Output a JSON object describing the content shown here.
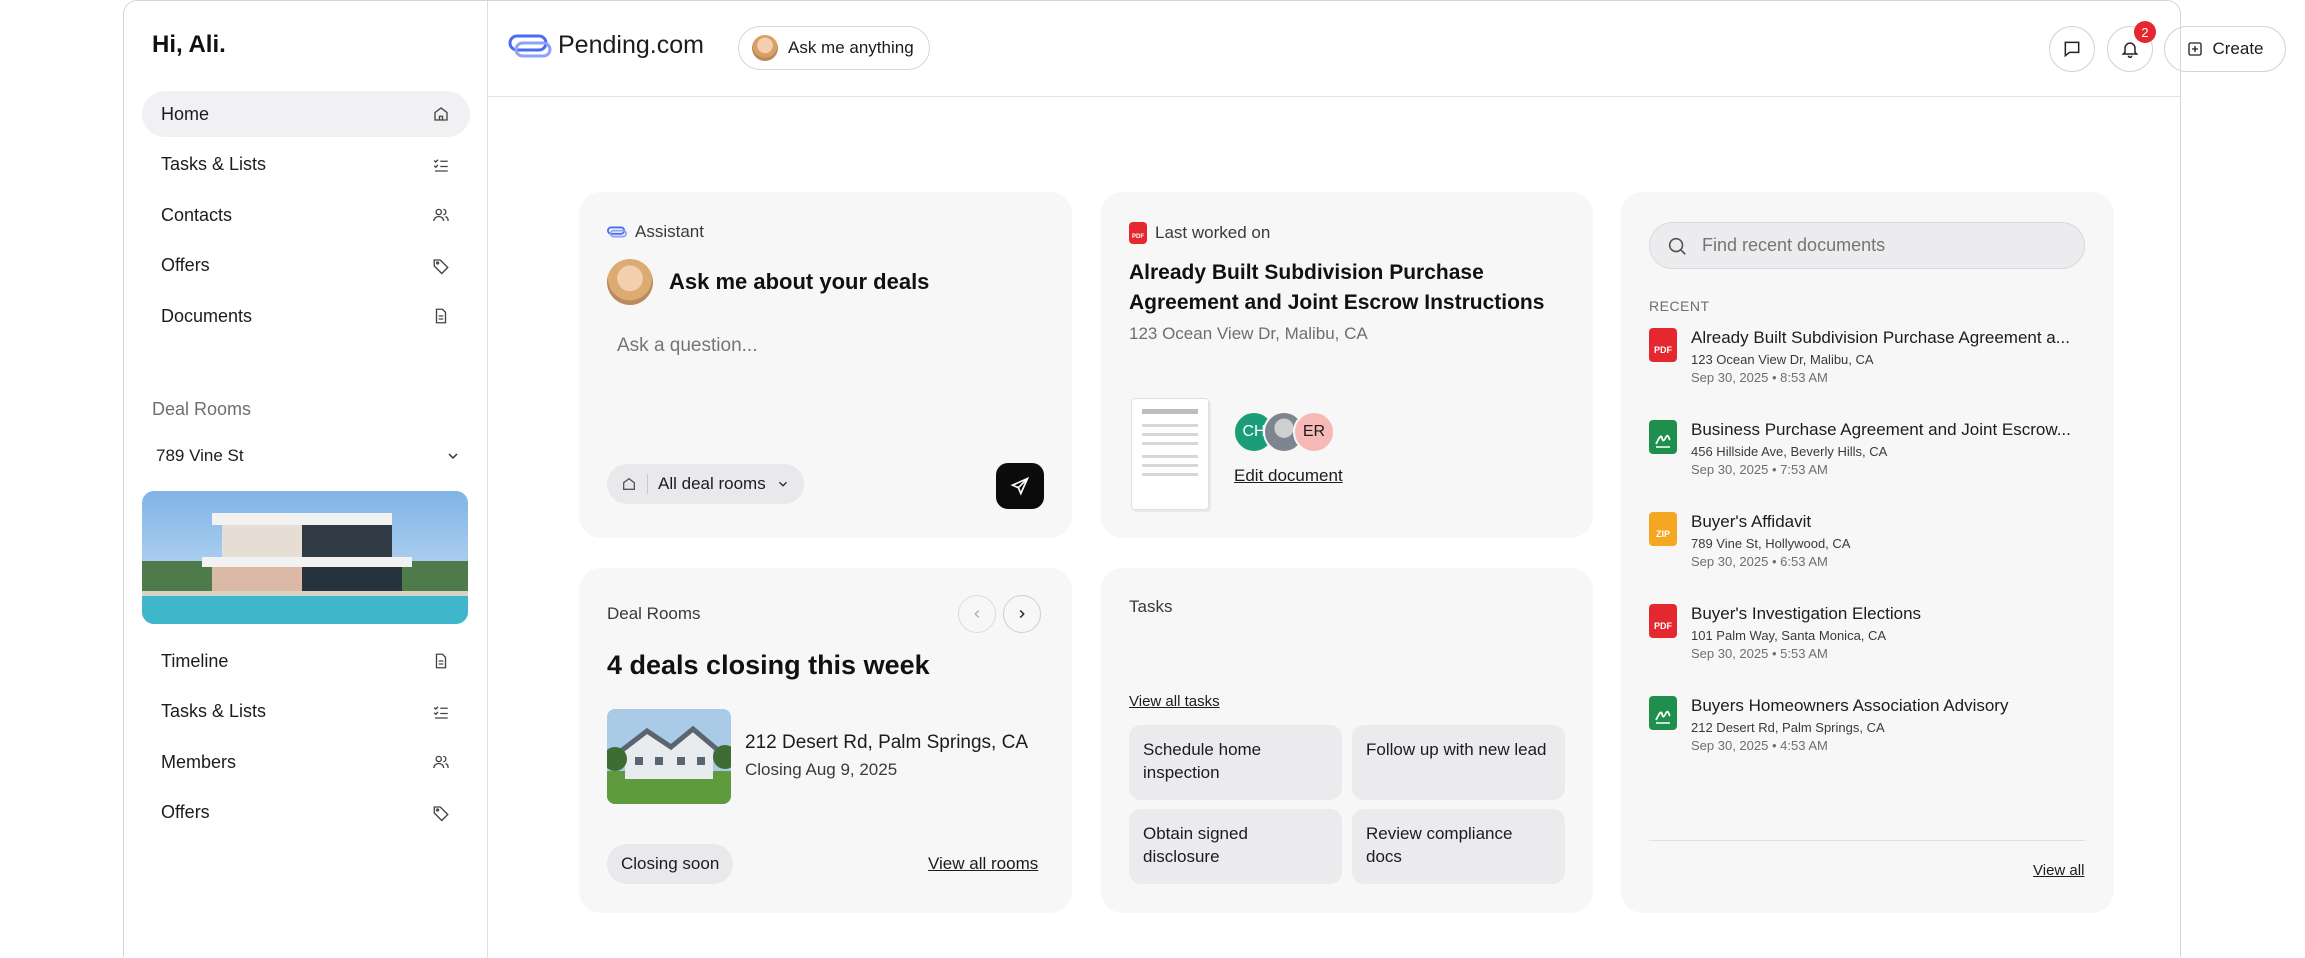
{
  "sidebar": {
    "greeting": "Hi, Ali.",
    "nav": [
      {
        "label": "Home",
        "icon": "home-icon"
      },
      {
        "label": "Tasks & Lists",
        "icon": "checklist-icon"
      },
      {
        "label": "Contacts",
        "icon": "users-icon"
      },
      {
        "label": "Offers",
        "icon": "tag-icon"
      },
      {
        "label": "Documents",
        "icon": "document-icon"
      }
    ],
    "deal_rooms_label": "Deal Rooms",
    "selected_room": "789 Vine St",
    "room_nav": [
      {
        "label": "Timeline",
        "icon": "document-icon"
      },
      {
        "label": "Tasks & Lists",
        "icon": "checklist-icon"
      },
      {
        "label": "Members",
        "icon": "users-icon"
      },
      {
        "label": "Offers",
        "icon": "tag-icon"
      }
    ]
  },
  "topbar": {
    "brand": "Pending.com",
    "ask_label": "Ask me anything",
    "notification_count": "2",
    "create_label": "Create"
  },
  "assistant": {
    "label": "Assistant",
    "title": "Ask me about your deals",
    "placeholder": "Ask a question...",
    "scope": "All deal rooms"
  },
  "last_worked": {
    "label": "Last worked on",
    "title": "Already Built Subdivision Purchase Agreement and Joint Escrow Instructions",
    "address": "123 Ocean View Dr, Malibu, CA",
    "avatars": [
      "CH",
      "",
      "ER"
    ],
    "edit_label": "Edit document"
  },
  "deal_rooms_card": {
    "label": "Deal Rooms",
    "title": "4 deals closing this week",
    "property": "212 Desert Rd, Palm Springs, CA",
    "closing": "Closing Aug 9, 2025",
    "tag": "Closing soon",
    "view_all": "View all rooms"
  },
  "tasks": {
    "label": "Tasks",
    "view_all": "View all tasks",
    "items": [
      "Schedule home inspection",
      "Follow up with new lead",
      "Obtain signed disclosure",
      "Review compliance docs"
    ]
  },
  "recent": {
    "search_placeholder": "Find recent documents",
    "heading": "RECENT",
    "view_all": "View all",
    "docs": [
      {
        "title": "Already Built Subdivision Purchase Agreement a...",
        "address": "123 Ocean View Dr, Malibu, CA",
        "date": "Sep 30, 2025 • 8:53 AM",
        "type": "PDF",
        "color": "#e5282f"
      },
      {
        "title": "Business Purchase Agreement and Joint Escrow...",
        "address": "456 Hillside Ave, Beverly Hills, CA",
        "date": "Sep 30, 2025 • 7:53 AM",
        "type": "",
        "color": "#1f8f4e"
      },
      {
        "title": "Buyer's Affidavit",
        "address": "789 Vine St, Hollywood, CA",
        "date": "Sep 30, 2025 • 6:53 AM",
        "type": "ZIP",
        "color": "#f5a623"
      },
      {
        "title": "Buyer's Investigation Elections",
        "address": "101 Palm Way, Santa Monica, CA",
        "date": "Sep 30, 2025 • 5:53 AM",
        "type": "PDF",
        "color": "#e5282f"
      },
      {
        "title": "Buyers Homeowners Association Advisory",
        "address": "212 Desert Rd, Palm Springs, CA",
        "date": "Sep 30, 2025 • 4:53 AM",
        "type": "",
        "color": "#1f8f4e"
      }
    ]
  }
}
